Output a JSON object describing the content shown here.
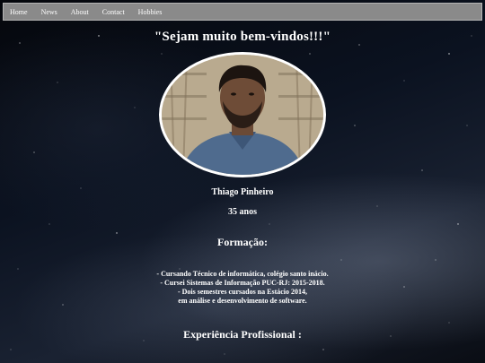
{
  "nav": {
    "items": [
      {
        "label": "Home"
      },
      {
        "label": "News"
      },
      {
        "label": "About"
      },
      {
        "label": "Contact"
      },
      {
        "label": "Hobbies"
      }
    ]
  },
  "header": {
    "welcome": "\"Sejam muito bem-vindos!!!\""
  },
  "profile": {
    "name": "Thiago Pinheiro",
    "age": "35 anos"
  },
  "formacao": {
    "title": "Formação:",
    "lines": [
      "- Cursando Técnico de informática, colégio santo inácio.",
      "- Cursei Sistemas de Informação PUC-RJ: 2015-2018.",
      "- Dois semestres cursados na Estácio 2014,",
      "em análise e desenvolvimento de software."
    ]
  },
  "experiencia": {
    "title": "Experiência Profissional :"
  },
  "colors": {
    "navbar": "#8a8a8a",
    "text": "#ffffff",
    "photo_border": "#ffffff"
  }
}
